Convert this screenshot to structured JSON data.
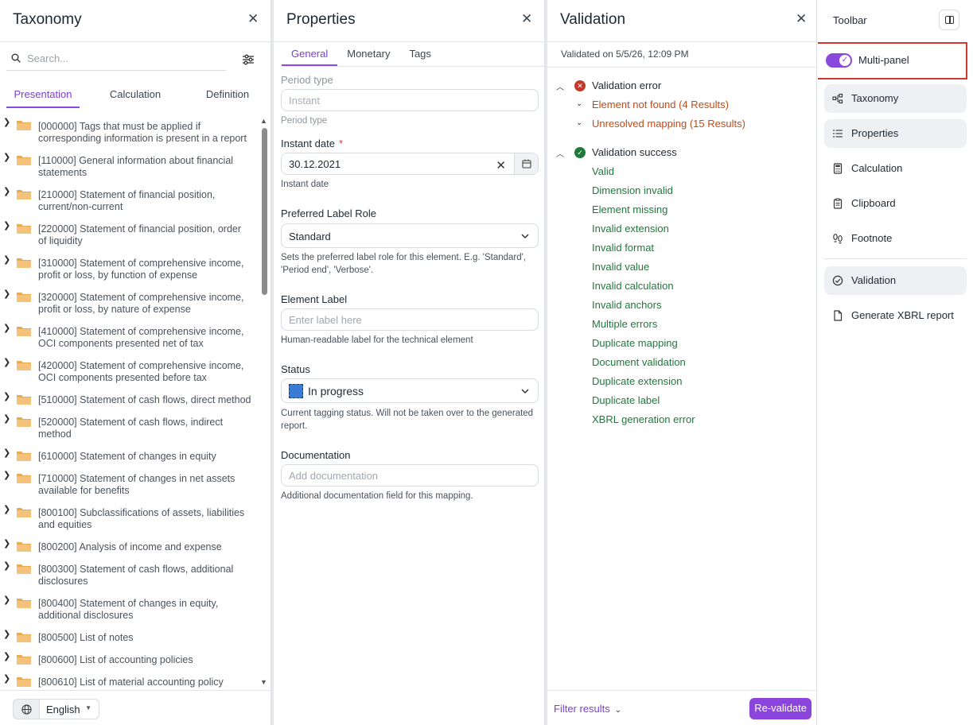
{
  "taxonomy": {
    "title": "Taxonomy",
    "search_placeholder": "Search...",
    "tabs": [
      "Presentation",
      "Calculation",
      "Definition"
    ],
    "items": [
      "[000000] Tags that must be applied if corresponding information is present in a report",
      "[110000] General information about financial statements",
      "[210000] Statement of financial position, current/non-current",
      "[220000] Statement of financial position, order of liquidity",
      "[310000] Statement of comprehensive income, profit or loss, by function of expense",
      "[320000] Statement of comprehensive income, profit or loss, by nature of expense",
      "[410000] Statement of comprehensive income, OCI components presented net of tax",
      "[420000] Statement of comprehensive income, OCI components presented before tax",
      "[510000] Statement of cash flows, direct method",
      "[520000] Statement of cash flows, indirect method",
      "[610000] Statement of changes in equity",
      "[710000] Statement of changes in net assets available for benefits",
      "[800100] Subclassifications of assets, liabilities and equities",
      "[800200] Analysis of income and expense",
      "[800300] Statement of cash flows, additional disclosures",
      "[800400] Statement of changes in equity, additional disclosures",
      "[800500] List of notes",
      "[800600] List of accounting policies",
      "[800610] List of material accounting policy"
    ],
    "language": "English"
  },
  "properties": {
    "title": "Properties",
    "tabs": [
      "General",
      "Monetary",
      "Tags"
    ],
    "period_type_label": "Period type",
    "period_type_value": "Instant",
    "period_type_helper": "Period type",
    "instant_date_label": "Instant date",
    "required_mark": "*",
    "instant_date_value": "30.12.2021",
    "instant_date_helper": "Instant date",
    "label_role_label": "Preferred Label Role",
    "label_role_value": "Standard",
    "label_role_helper": "Sets the preferred label role for this element. E.g. 'Standard', 'Period end', 'Verbose'.",
    "element_label_label": "Element Label",
    "element_label_placeholder": "Enter label here",
    "element_label_helper": "Human-readable label for the technical element",
    "status_label": "Status",
    "status_value": "In progress",
    "status_helper": "Current tagging status. Will not be taken over to the generated report.",
    "documentation_label": "Documentation",
    "documentation_placeholder": "Add documentation",
    "documentation_helper": "Additional documentation field for this mapping."
  },
  "validation": {
    "title": "Validation",
    "validated_on": "Validated on 5/5/26, 12:09 PM",
    "error_group": "Validation error",
    "error_items": [
      "Element not found (4 Results)",
      "Unresolved mapping (15 Results)"
    ],
    "success_group": "Validation success",
    "success_items": [
      "Valid",
      "Dimension invalid",
      "Element missing",
      "Invalid extension",
      "Invalid format",
      "Invalid value",
      "Invalid calculation",
      "Invalid anchors",
      "Multiple errors",
      "Duplicate mapping",
      "Document validation",
      "Duplicate extension",
      "Duplicate label",
      "XBRL generation error"
    ],
    "filter_label": "Filter results",
    "revalidate_label": "Re-validate"
  },
  "toolbar": {
    "title": "Toolbar",
    "multi_panel_label": "Multi-panel",
    "multi_panel_on": true,
    "items": [
      {
        "label": "Taxonomy",
        "icon": "taxonomy-icon",
        "active": true
      },
      {
        "label": "Properties",
        "icon": "list-icon",
        "active": true
      },
      {
        "label": "Calculation",
        "icon": "calculator-icon",
        "active": false
      },
      {
        "label": "Clipboard",
        "icon": "clipboard-icon",
        "active": false
      },
      {
        "label": "Footnote",
        "icon": "footnote-icon",
        "active": false
      }
    ],
    "items2": [
      {
        "label": "Validation",
        "icon": "check-circle-icon",
        "active": true
      },
      {
        "label": "Generate XBRL report",
        "icon": "document-icon",
        "active": false
      }
    ]
  },
  "colors": {
    "accent": "#8b45dc",
    "error": "#c24a16",
    "success": "#1e7a3a",
    "highlight": "#d0392b"
  }
}
